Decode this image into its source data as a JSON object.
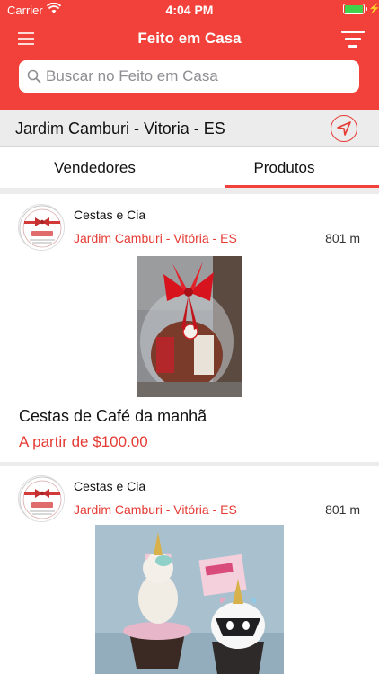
{
  "status_bar": {
    "carrier": "Carrier",
    "time": "4:04 PM"
  },
  "nav": {
    "title": "Feito em Casa",
    "left_icon": "hamburger-menu-icon",
    "right_icon": "filter-icon"
  },
  "search": {
    "placeholder": "Buscar no Feito em Casa",
    "value": ""
  },
  "location": {
    "label": "Jardim Camburi - Vitoria - ES",
    "icon": "location-arrow-icon"
  },
  "tabs": [
    {
      "label": "Vendedores",
      "active": false
    },
    {
      "label": "Produtos",
      "active": true
    }
  ],
  "products": [
    {
      "vendor": "Cestas  e Cia",
      "vendor_location": "Jardim Camburi - Vitória - ES",
      "distance": "801 m",
      "title": "Cestas de Café da manhã",
      "price": "A partir de $100.00"
    },
    {
      "vendor": "Cestas  e Cia",
      "vendor_location": "Jardim Camburi - Vitória - ES",
      "distance": "801 m"
    }
  ],
  "colors": {
    "brand_red": "#f2413a",
    "accent_text_red": "#e53b34"
  }
}
